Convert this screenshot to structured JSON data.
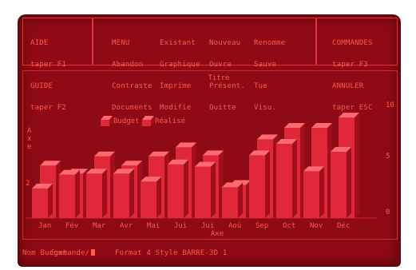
{
  "help": {
    "lines": [
      "AIDE",
      "taper F1",
      "GUIDE",
      "taper F2"
    ]
  },
  "menu": {
    "col1": [
      "MENU",
      "Abandon",
      "Contraste",
      "Documents"
    ],
    "col2": [
      "Existant",
      "Graphique",
      "Imprime",
      "Modifie"
    ],
    "col3": [
      "Nouveau",
      "Ouvre",
      "Présent.",
      "Quitte"
    ],
    "col4": [
      "Renomme",
      "Sauve",
      "Tue",
      "Visu."
    ]
  },
  "commands": {
    "lines": [
      "COMMANDES",
      "taper F3",
      "ANNULER",
      "taper ESC"
    ]
  },
  "chart_data": {
    "type": "bar",
    "title": "Titre",
    "xlabel": "Axe",
    "ylabel": "Axe",
    "categories": [
      "Jan",
      "Fév",
      "Mar",
      "Avr",
      "Mai",
      "Jui",
      "Jui",
      "Aoû",
      "Sep",
      "Oct",
      "Nov",
      "Déc"
    ],
    "series": [
      {
        "name": "Budget",
        "values": [
          2.6,
          3.8,
          3.9,
          3.9,
          3.2,
          4.7,
          4.5,
          2.7,
          5.5,
          6.5,
          4.1,
          5.8
        ]
      },
      {
        "name": "Réalisé",
        "values": [
          4.6,
          3.9,
          5.4,
          4.6,
          5.4,
          6.2,
          5.5,
          2.9,
          6.9,
          7.9,
          7.9,
          8.8
        ]
      }
    ],
    "ylim": [
      0,
      10
    ],
    "yticks_right": [
      "10",
      "5",
      "0"
    ],
    "ytick_left": "2",
    "legend_position": "top-left",
    "colors": {
      "bar": "#e0283a",
      "bar_light": "#ff6a70",
      "bar_dark": "#a0101c",
      "text": "#ff5a4a"
    }
  },
  "status": {
    "command_prompt": "commande/",
    "file_name": "Nom Budget",
    "format_info": "Format 4 Style BARRE-3D 1"
  },
  "colors": {
    "screen": "#8e0a14",
    "text": "#ff5a4a",
    "frame": "#e2323a"
  }
}
